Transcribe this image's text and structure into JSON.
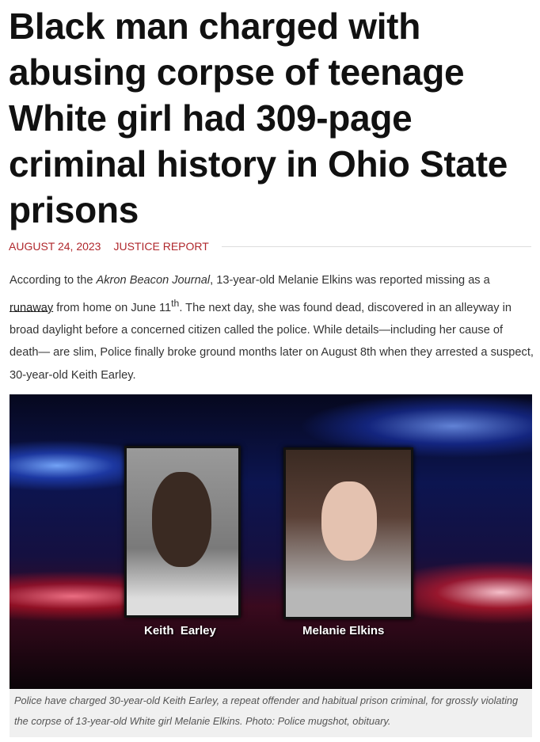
{
  "article": {
    "title": "Black man charged with abusing corpse of teenage White girl had 309-page criminal history in Ohio State prisons",
    "date": "AUGUST 24, 2023",
    "category": "JUSTICE REPORT",
    "body": {
      "p1_intro": "According to the ",
      "p1_source": "Akron Beacon Journal",
      "p1_a": ", 13-year-old Melanie Elkins was reported missing as a ",
      "p1_link": "runaway",
      "p1_b": " from home on June 11",
      "p1_sup": "th",
      "p1_c": ". The next day, she was found dead, discovered in an alleyway in broad daylight before a concerned citizen called the police. While details—including her cause of death— are slim, Police finally broke ground months later on August 8th when they arrested a suspect, 30-year-old Keith Earley."
    },
    "image": {
      "label_left": "Keith  Earley",
      "label_right": "Melanie Elkins",
      "caption": "Police have charged 30-year-old Keith Earley, a repeat offender and habitual prison criminal, for grossly violating the corpse of 13-year-old White girl Melanie Elkins. Photo: Police mugshot, obituary."
    }
  }
}
